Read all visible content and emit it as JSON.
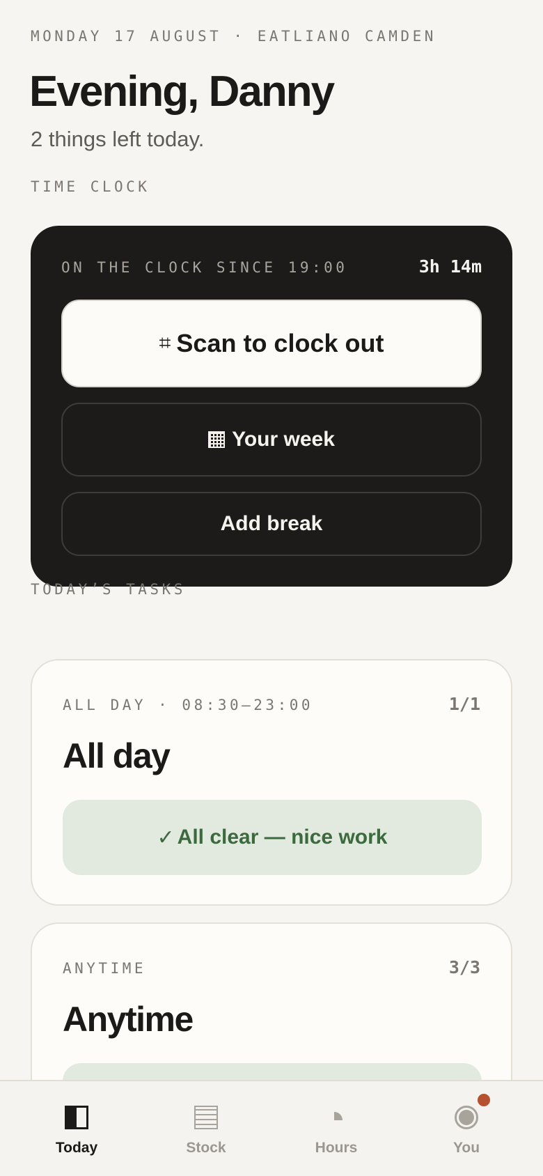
{
  "header": {
    "eyebrow": "MONDAY 17 AUGUST · EATLIANO CAMDEN",
    "greeting": "Evening, Danny",
    "subtitle": "2 things left today."
  },
  "time_clock": {
    "section_label": "TIME CLOCK",
    "since_label": "ON THE CLOCK SINCE 19:00",
    "duration": "3h 14m",
    "primary_button": {
      "icon": "⌗",
      "label": "Scan to clock out"
    },
    "week_button": {
      "label": "Your week"
    },
    "break_button": {
      "label": "Add break"
    }
  },
  "tasks": {
    "section_label": "TODAY’S TASKS",
    "groups": [
      {
        "meta": "ALL DAY · 08:30–23:00",
        "count": "1/1",
        "title": "All day",
        "status": "All clear — nice work",
        "status_icon": "✓"
      },
      {
        "meta": "ANYTIME",
        "count": "3/3",
        "title": "Anytime"
      }
    ]
  },
  "nav": {
    "items": [
      {
        "label": "Today",
        "icon": "today-icon",
        "active": true
      },
      {
        "label": "Stock",
        "icon": "stock-icon"
      },
      {
        "label": "Hours",
        "icon": "hours-icon"
      },
      {
        "label": "You",
        "icon": "profile-icon",
        "has_notification": true
      }
    ]
  },
  "colors": {
    "background": "#f7f5f1",
    "dark_card": "#1c1b19",
    "success_bg": "#e2eadf",
    "success_text": "#3c6a3e",
    "notification": "#b7502f"
  }
}
